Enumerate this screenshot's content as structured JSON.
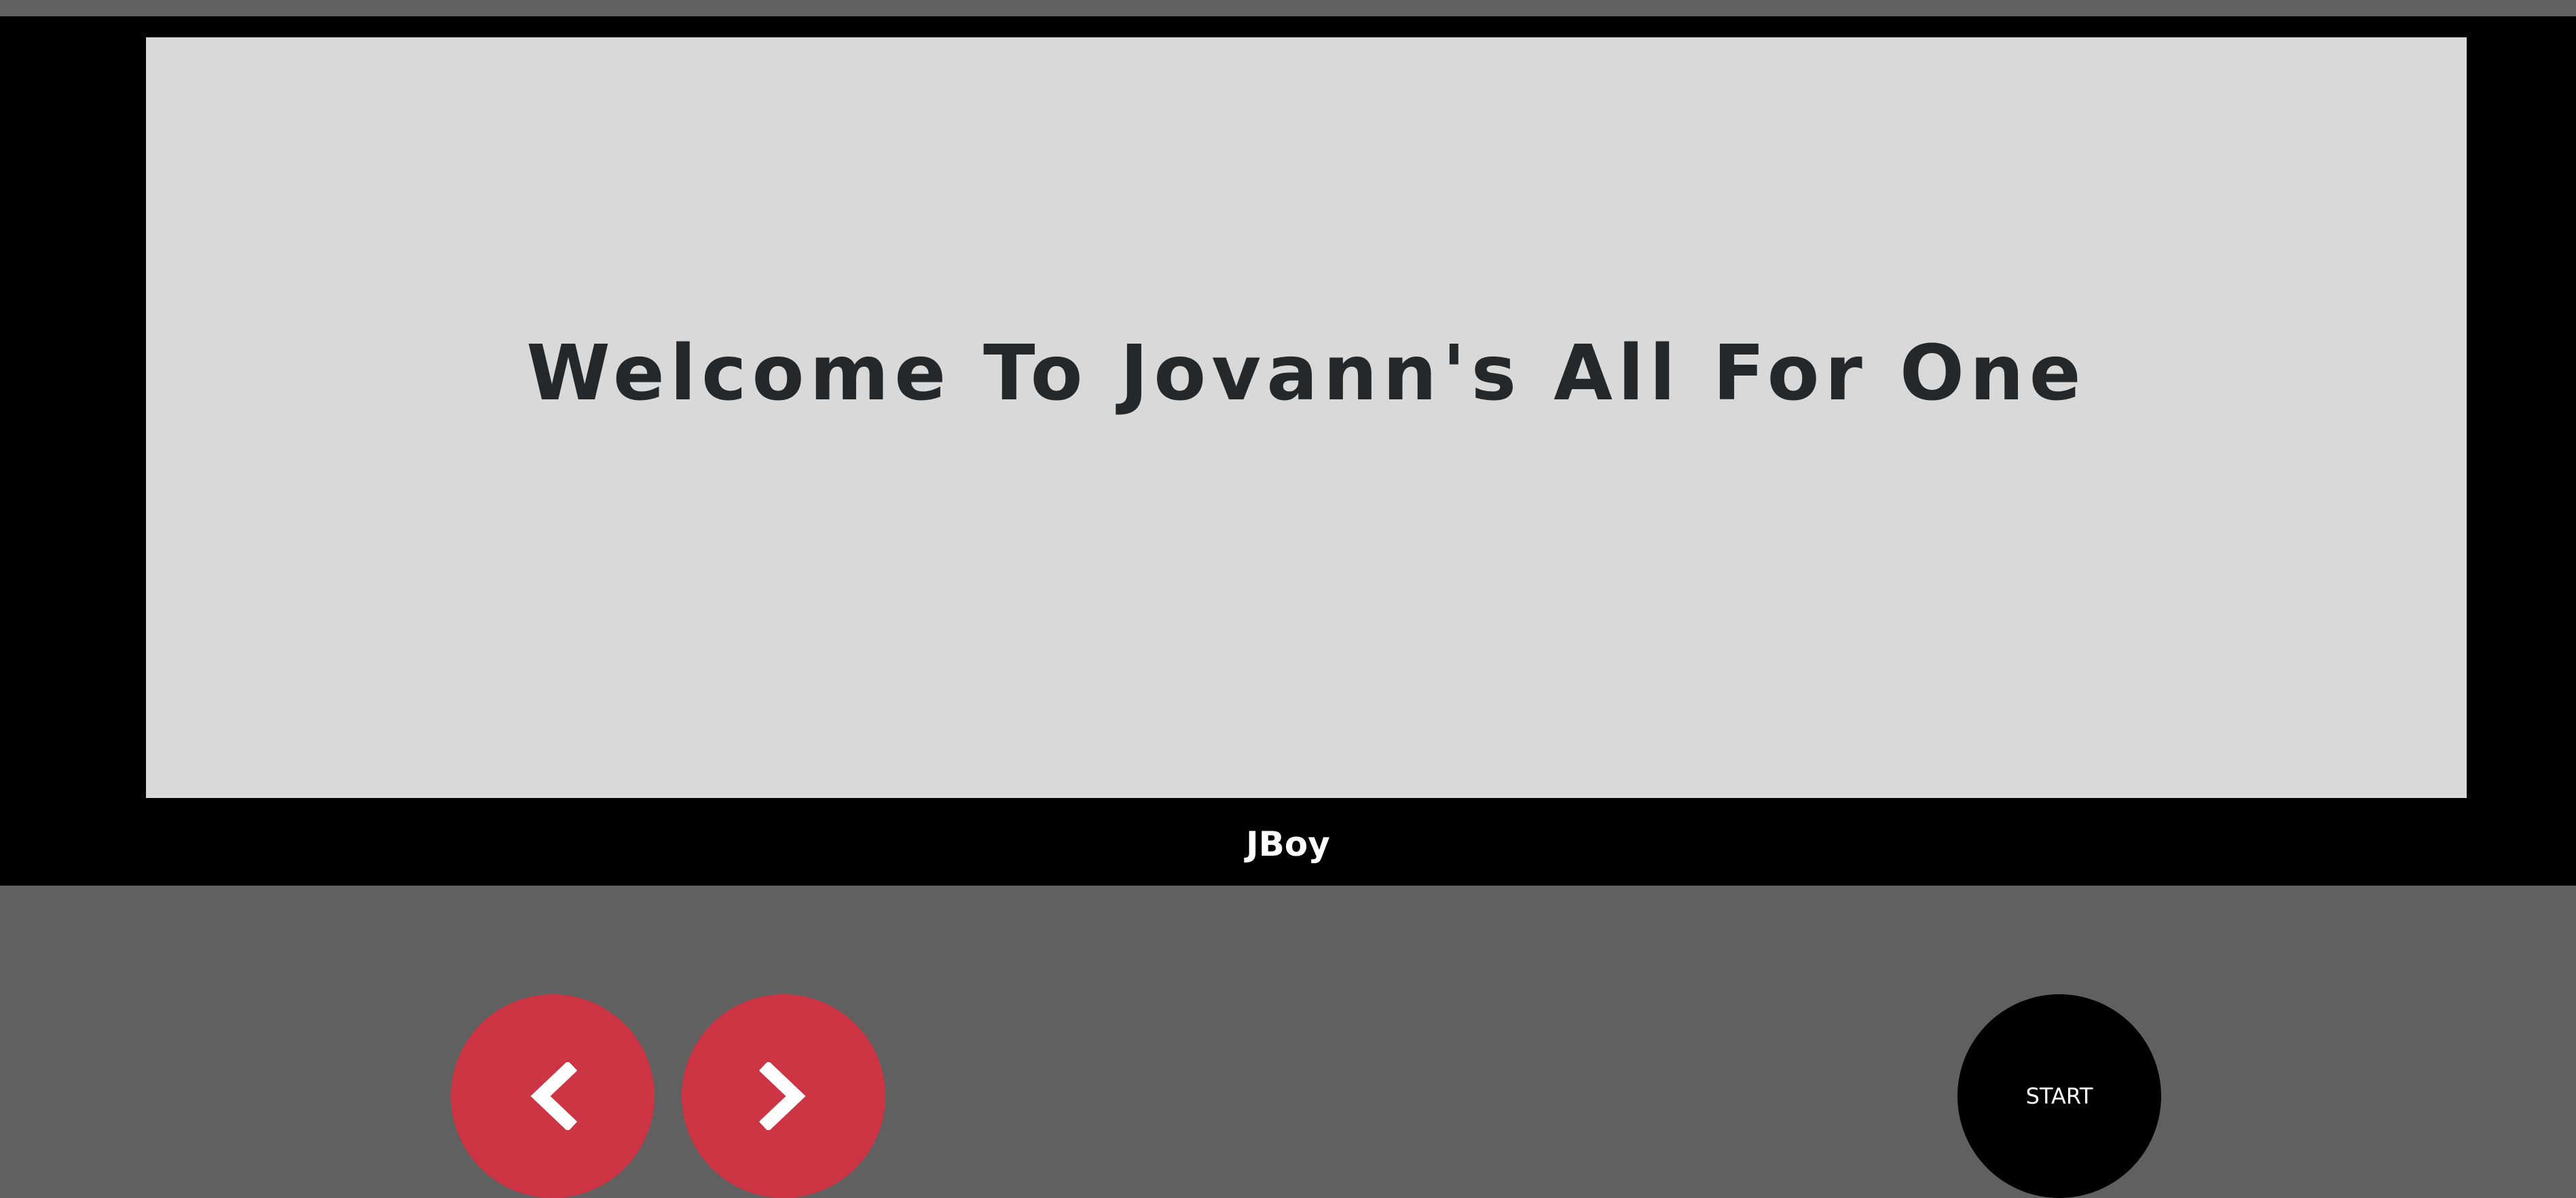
{
  "screen": {
    "title": "Welcome To Jovann's All For One"
  },
  "device": {
    "brand": "JBoy"
  },
  "controls": {
    "prev_icon": "chevron-left-icon",
    "next_icon": "chevron-right-icon",
    "start_label": "START"
  },
  "colors": {
    "background": "#606060",
    "bezel": "#000000",
    "screen": "#d9d9d9",
    "title_text": "#25282b",
    "arrow_button": "#cd3545",
    "start_button": "#000000"
  }
}
